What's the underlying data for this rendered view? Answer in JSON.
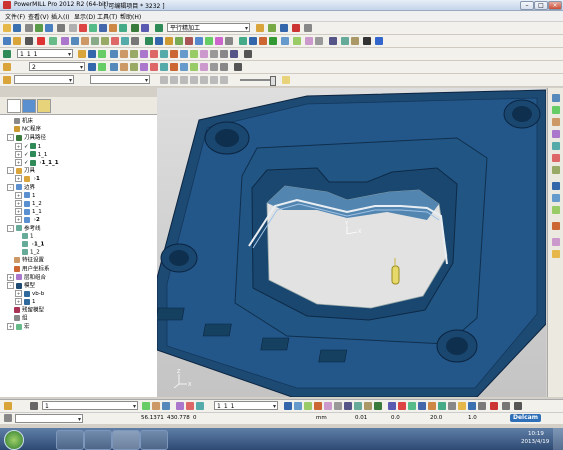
{
  "window": {
    "title": "PowerMILL Pro 2012 R2 (64-bit)",
    "project": "[ 可编辑项目 * 3232 ]"
  },
  "menu": {
    "items": [
      "文件(F)",
      "查看(V)",
      "插入(I)",
      "显示(D)",
      "工具(T)",
      "帮助(H)"
    ]
  },
  "toolbar1": {
    "strategy_value": "平行精加工"
  },
  "toolbar3": {
    "toolpath_value": "1_1_1"
  },
  "toolbar4": {
    "tool_value": "2"
  },
  "explorer": {
    "tree": [
      {
        "label": "机床",
        "level": 0,
        "expand": "",
        "icon": "machine"
      },
      {
        "label": "NC程序",
        "level": 0,
        "expand": "",
        "icon": "nc"
      },
      {
        "label": "刀具路径",
        "level": 0,
        "expand": "-",
        "icon": "toolpath"
      },
      {
        "label": "1",
        "level": 1,
        "expand": "+",
        "icon": "tp",
        "check": "✓"
      },
      {
        "label": "1_1",
        "level": 1,
        "expand": "+",
        "icon": "tp",
        "check": "✓"
      },
      {
        "label": "1_1_1",
        "level": 1,
        "expand": "+",
        "icon": "tp",
        "check": "✓",
        "active": true
      },
      {
        "label": "刀具",
        "level": 0,
        "expand": "-",
        "icon": "tool"
      },
      {
        "label": "1",
        "level": 1,
        "expand": "+",
        "icon": "tl",
        "active": true
      },
      {
        "label": "边界",
        "level": 0,
        "expand": "-",
        "icon": "boundary"
      },
      {
        "label": "1",
        "level": 1,
        "expand": "+",
        "icon": "bd"
      },
      {
        "label": "1_2",
        "level": 1,
        "expand": "+",
        "icon": "bd"
      },
      {
        "label": "1_1",
        "level": 1,
        "expand": "+",
        "icon": "bd"
      },
      {
        "label": "2",
        "level": 1,
        "expand": "+",
        "icon": "bd2",
        "active": true
      },
      {
        "label": "参考线",
        "level": 0,
        "expand": "-",
        "icon": "pattern"
      },
      {
        "label": "1",
        "level": 1,
        "expand": "",
        "icon": "pt"
      },
      {
        "label": "1_1",
        "level": 1,
        "expand": "",
        "icon": "pt",
        "active": true
      },
      {
        "label": "1_2",
        "level": 1,
        "expand": "",
        "icon": "pt"
      },
      {
        "label": "特征设置",
        "level": 0,
        "expand": "",
        "icon": "feature"
      },
      {
        "label": "用户坐标系",
        "level": 0,
        "expand": "",
        "icon": "ucs"
      },
      {
        "label": "层和组合",
        "level": 0,
        "expand": "+",
        "icon": "level"
      },
      {
        "label": "模型",
        "level": 0,
        "expand": "-",
        "icon": "model"
      },
      {
        "label": "vb-b",
        "level": 1,
        "expand": "+",
        "icon": "md"
      },
      {
        "label": "1",
        "level": 1,
        "expand": "+",
        "icon": "md"
      },
      {
        "label": "残留模型",
        "level": 0,
        "expand": "",
        "icon": "stock"
      },
      {
        "label": "组",
        "level": 0,
        "expand": "",
        "icon": "group"
      },
      {
        "label": "宏",
        "level": 0,
        "expand": "+",
        "icon": "macro"
      }
    ]
  },
  "viewport": {
    "axis_x": "X",
    "axis_y": "Y",
    "axis_z": "Z",
    "model_color": "#1d4a73",
    "model_dark": "#0f2f4e",
    "model_light": "#2e6a9e"
  },
  "bottombar1": {
    "tool_value": "1",
    "toolpath_value": "1_1_1"
  },
  "statusbar": {
    "x": "56.1371",
    "y": "430.778",
    "z": "0",
    "unit": "mm",
    "tolerance": "0.01",
    "thickness": "0.0",
    "stepover": "20.0",
    "other": "1.0",
    "brand": "Delcam"
  },
  "taskbar": {
    "time": "10:19",
    "date": "2013/4/19"
  }
}
